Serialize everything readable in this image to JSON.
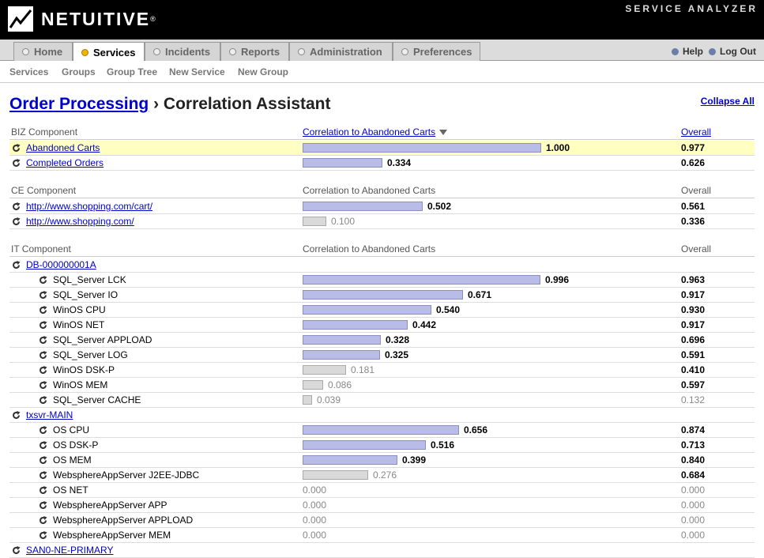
{
  "header": {
    "logo_text": "NETUITIVE",
    "logo_mark": "®",
    "product": "SERVICE ANALYZER"
  },
  "tabs": [
    {
      "label": "Home"
    },
    {
      "label": "Services"
    },
    {
      "label": "Incidents"
    },
    {
      "label": "Reports"
    },
    {
      "label": "Administration"
    },
    {
      "label": "Preferences"
    }
  ],
  "utility": {
    "help": "Help",
    "logout": "Log Out"
  },
  "subnav": {
    "items": [
      "Services",
      "Groups",
      "Group Tree",
      "New Service",
      "New Group"
    ]
  },
  "page": {
    "title_link": "Order Processing",
    "title_sep": " › ",
    "title_rest": "Correlation Assistant",
    "collapse_all": "Collapse All"
  },
  "sections": [
    {
      "component": "BIZ Component",
      "corr_header": "Correlation to Abandoned Carts",
      "overall_header": "Overall"
    },
    {
      "component": "CE Component",
      "corr_header": "Correlation to Abandoned Carts",
      "overall_header": "Overall"
    },
    {
      "component": "IT Component",
      "corr_header": "Correlation to Abandoned Carts",
      "overall_header": "Overall"
    }
  ],
  "rows": [
    {
      "name": "Abandoned Carts",
      "value": "1.000",
      "overall": "0.977",
      "corr": 1.0
    },
    {
      "name": "Completed Orders",
      "value": "0.334",
      "overall": "0.626",
      "corr": 0.334
    },
    {
      "name": "http://www.shopping.com/cart/",
      "value": "0.502",
      "overall": "0.561",
      "corr": 0.502
    },
    {
      "name": "http://www.shopping.com/",
      "value": "0.100",
      "overall": "0.336",
      "corr": 0.1
    },
    {
      "name": "DB-000000001A",
      "value": "",
      "overall": "",
      "corr": 0
    },
    {
      "name": "SQL_Server LCK",
      "value": "0.996",
      "overall": "0.963",
      "corr": 0.996
    },
    {
      "name": "SQL_Server IO",
      "value": "0.671",
      "overall": "0.917",
      "corr": 0.671
    },
    {
      "name": "WinOS CPU",
      "value": "0.540",
      "overall": "0.930",
      "corr": 0.54
    },
    {
      "name": "WinOS NET",
      "value": "0.442",
      "overall": "0.917",
      "corr": 0.442
    },
    {
      "name": "SQL_Server APPLOAD",
      "value": "0.328",
      "overall": "0.696",
      "corr": 0.328
    },
    {
      "name": "SQL_Server LOG",
      "value": "0.325",
      "overall": "0.591",
      "corr": 0.325
    },
    {
      "name": "WinOS DSK-P",
      "value": "0.181",
      "overall": "0.410",
      "corr": 0.181
    },
    {
      "name": "WinOS MEM",
      "value": "0.086",
      "overall": "0.597",
      "corr": 0.086
    },
    {
      "name": "SQL_Server CACHE",
      "value": "0.039",
      "overall": "0.132",
      "corr": 0.039
    },
    {
      "name": "txsvr-MAIN",
      "value": "",
      "overall": "",
      "corr": 0
    },
    {
      "name": "OS CPU",
      "value": "0.656",
      "overall": "0.874",
      "corr": 0.656
    },
    {
      "name": "OS DSK-P",
      "value": "0.516",
      "overall": "0.713",
      "corr": 0.516
    },
    {
      "name": "OS MEM",
      "value": "0.399",
      "overall": "0.840",
      "corr": 0.399
    },
    {
      "name": "WebsphereAppServer J2EE-JDBC",
      "value": "0.276",
      "overall": "0.684",
      "corr": 0.276
    },
    {
      "name": "OS NET",
      "value": "0.000",
      "overall": "0.000",
      "corr": 0
    },
    {
      "name": "WebsphereAppServer APP",
      "value": "0.000",
      "overall": "0.000",
      "corr": 0
    },
    {
      "name": "WebsphereAppServer APPLOAD",
      "value": "0.000",
      "overall": "0.000",
      "corr": 0
    },
    {
      "name": "WebsphereAppServer MEM",
      "value": "0.000",
      "overall": "0.000",
      "corr": 0
    },
    {
      "name": "SAN0-NE-PRIMARY",
      "value": "",
      "overall": "",
      "corr": 0
    }
  ]
}
